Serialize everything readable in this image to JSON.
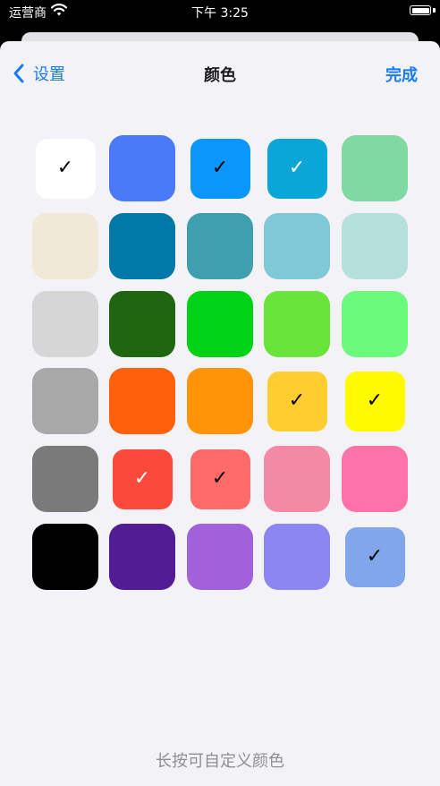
{
  "status_bar": {
    "carrier": "运营商",
    "time": "下午 3:25"
  },
  "nav": {
    "back_label": "设置",
    "title": "颜色",
    "done_label": "完成"
  },
  "swatch_rows": [
    [
      {
        "color": "#ffffff",
        "selected": true,
        "check_color": "#000000"
      },
      {
        "color": "#4a7af7",
        "selected": false
      },
      {
        "color": "#0a96fa",
        "selected": true,
        "check_color": "#000000"
      },
      {
        "color": "#0aa6d8",
        "selected": true,
        "check_color": "#ffffff"
      },
      {
        "color": "#80d8a2",
        "selected": false
      }
    ],
    [
      {
        "color": "#f1e9d8",
        "selected": false
      },
      {
        "color": "#0079a8",
        "selected": false
      },
      {
        "color": "#3e9fae",
        "selected": false
      },
      {
        "color": "#80c8d5",
        "selected": false
      },
      {
        "color": "#b6e0dc",
        "selected": false
      }
    ],
    [
      {
        "color": "#d6d6d6",
        "selected": false
      },
      {
        "color": "#206610",
        "selected": false
      },
      {
        "color": "#00d216",
        "selected": false
      },
      {
        "color": "#68e43a",
        "selected": false
      },
      {
        "color": "#6bfa7b",
        "selected": false
      }
    ],
    [
      {
        "color": "#a8a8a8",
        "selected": false
      },
      {
        "color": "#fe600b",
        "selected": false
      },
      {
        "color": "#ff9409",
        "selected": false
      },
      {
        "color": "#fecd2f",
        "selected": true,
        "check_color": "#000000"
      },
      {
        "color": "#fffa00",
        "selected": true,
        "check_color": "#000000"
      }
    ],
    [
      {
        "color": "#7a7a7a",
        "selected": false
      },
      {
        "color": "#fb4a3c",
        "selected": true,
        "check_color": "#ffffff"
      },
      {
        "color": "#fd6b68",
        "selected": true,
        "check_color": "#000000"
      },
      {
        "color": "#f28aa6",
        "selected": false
      },
      {
        "color": "#fd72a8",
        "selected": false
      }
    ],
    [
      {
        "color": "#000000",
        "selected": false
      },
      {
        "color": "#521d94",
        "selected": false
      },
      {
        "color": "#a061da",
        "selected": false
      },
      {
        "color": "#8b86f2",
        "selected": false
      },
      {
        "color": "#81a6ea",
        "selected": true,
        "check_color": "#000000"
      }
    ]
  ],
  "check_glyph": "✓",
  "footer_hint": "长按可自定义颜色",
  "accent_color": "#1a7cf5"
}
